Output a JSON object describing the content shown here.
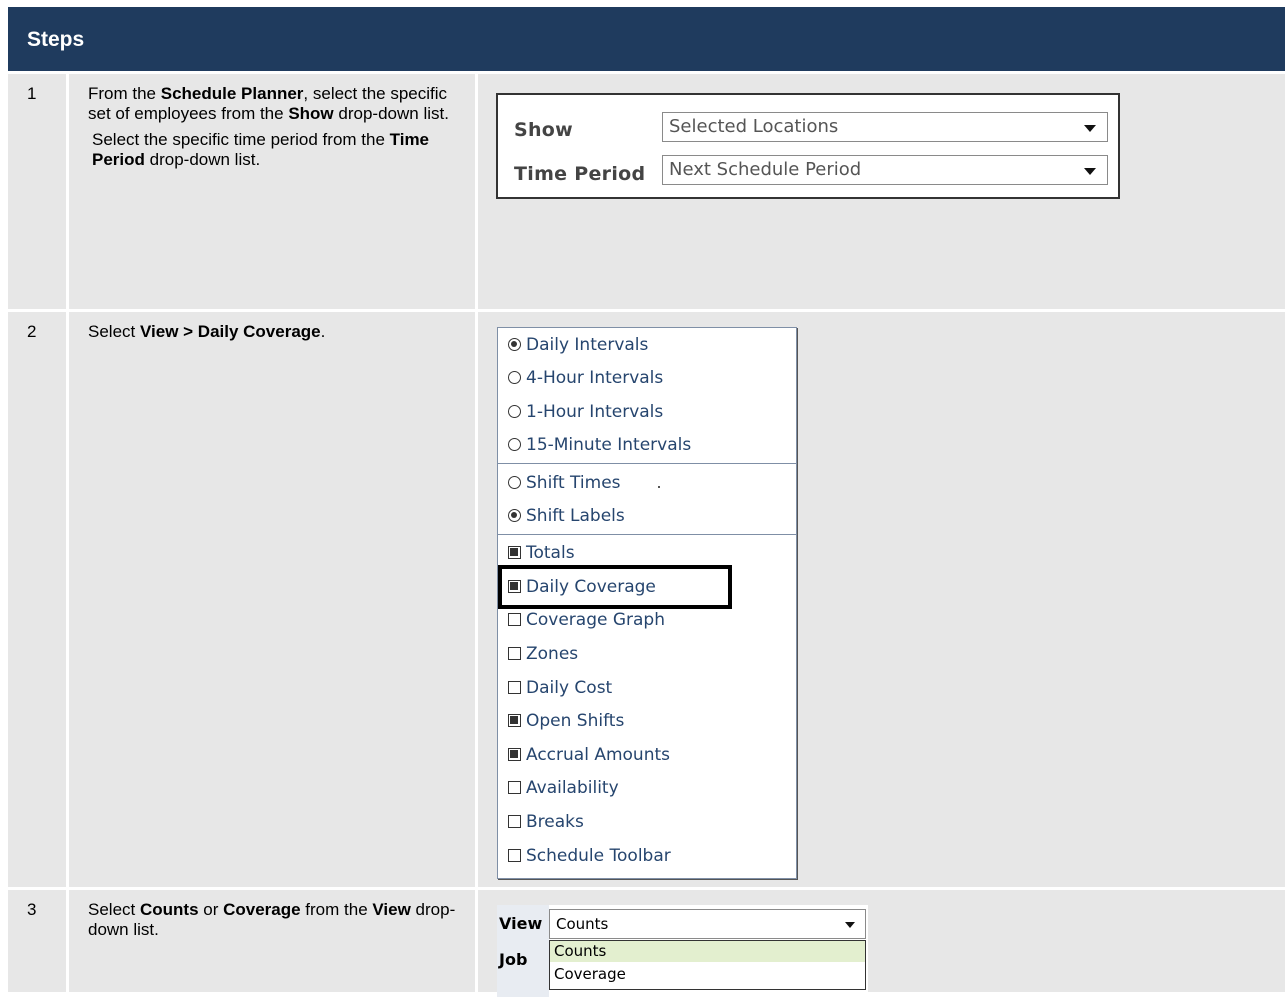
{
  "header": {
    "title": "Steps"
  },
  "steps": [
    {
      "number": "1",
      "paragraph1": {
        "pre": "From the ",
        "b1": "Schedule Planner",
        "mid1": ", select the specific set of employees from the ",
        "b2": "Show",
        "post": " drop-down list."
      },
      "paragraph2": {
        "pre": " Select the specific time period from the ",
        "b1": "Time Period",
        "post": " drop-down list."
      },
      "screenshot": {
        "show_label": "Show",
        "show_value": "Selected Locations",
        "period_label": "Time Period",
        "period_value": "Next Schedule Period"
      }
    },
    {
      "number": "2",
      "paragraph1": {
        "pre": "Select ",
        "b1": "View > Daily Coverage",
        "post": "."
      },
      "menu": {
        "intervals": [
          {
            "label": "Daily Intervals",
            "checked": true
          },
          {
            "label": "4-Hour Intervals",
            "checked": false
          },
          {
            "label": "1-Hour Intervals",
            "checked": false
          },
          {
            "label": "15-Minute Intervals",
            "checked": false
          }
        ],
        "shift_display": [
          {
            "label": "Shift Times",
            "checked": false
          },
          {
            "label": "Shift Labels",
            "checked": true
          }
        ],
        "options": [
          {
            "label": "Totals",
            "checked": true
          },
          {
            "label": "Daily Coverage",
            "checked": true
          },
          {
            "label": "Coverage Graph",
            "checked": false
          },
          {
            "label": "Zones",
            "checked": false
          },
          {
            "label": "Daily Cost",
            "checked": false
          },
          {
            "label": "Open Shifts",
            "checked": true
          },
          {
            "label": "Accrual Amounts",
            "checked": true
          },
          {
            "label": "Availability",
            "checked": false
          },
          {
            "label": "Breaks",
            "checked": false
          },
          {
            "label": "Schedule Toolbar",
            "checked": false
          }
        ]
      }
    },
    {
      "number": "3",
      "paragraph1": {
        "pre": "Select ",
        "b1": "Counts",
        "mid1": " or ",
        "b2": "Coverage",
        "mid2": " from the ",
        "b3": "View",
        "post": " drop-down list."
      },
      "screenshot": {
        "view_label": "View",
        "job_label": "Job",
        "view_value": "Counts",
        "options": [
          "Counts",
          "Coverage"
        ]
      }
    }
  ]
}
